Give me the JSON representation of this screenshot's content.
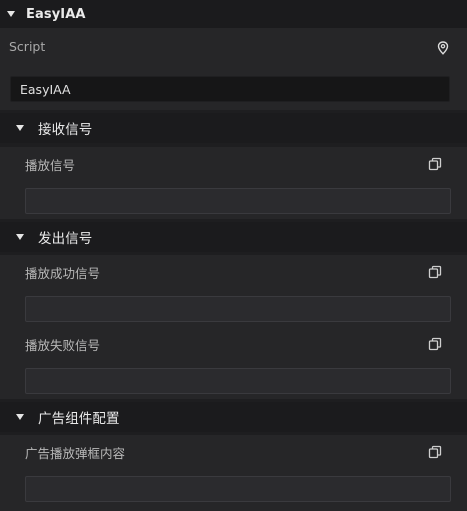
{
  "component": {
    "title": "EasyIAA",
    "script_label": "Script",
    "script_value": "EasyIAA",
    "locate_icon": "map-pin-icon"
  },
  "sections": [
    {
      "title": "接收信号",
      "fields": [
        {
          "label": "播放信号",
          "value": ""
        }
      ]
    },
    {
      "title": "发出信号",
      "fields": [
        {
          "label": "播放成功信号",
          "value": ""
        },
        {
          "label": "播放失败信号",
          "value": ""
        }
      ]
    },
    {
      "title": "广告组件配置",
      "fields": [
        {
          "label": "广告播放弹框内容",
          "value": ""
        }
      ]
    }
  ],
  "colors": {
    "background": "#1e1e20",
    "header_band": "#1b1b1d",
    "input_bg": "#2b2b2e",
    "text": "#d6d6d6"
  },
  "icons": {
    "collapse": "caret-down-icon",
    "copy": "copy-icon"
  }
}
